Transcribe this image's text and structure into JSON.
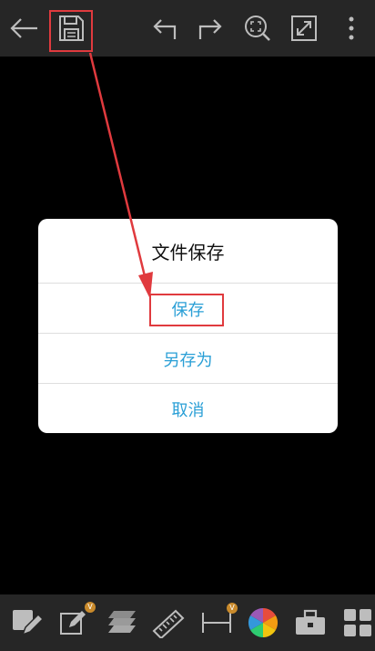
{
  "toolbar": {
    "icons": [
      "back-arrow-icon",
      "save-icon",
      "undo-icon",
      "redo-icon",
      "zoom-fit-icon",
      "fullscreen-icon",
      "more-vertical-icon"
    ]
  },
  "dialog": {
    "title": "文件保存",
    "options": [
      "保存",
      "另存为",
      "取消"
    ]
  },
  "bottom_toolbar": {
    "icons": [
      "edit-layer-icon",
      "edit-icon",
      "layers-icon",
      "ruler-icon",
      "dimension-icon",
      "color-wheel-icon",
      "toolbox-icon",
      "grid-icon"
    ],
    "badge": "V"
  },
  "colors": {
    "toolbar_bg": "#262626",
    "icon": "#bdbdbd",
    "dialog_option": "#2a9fd6",
    "annotation": "#e03a3e"
  }
}
